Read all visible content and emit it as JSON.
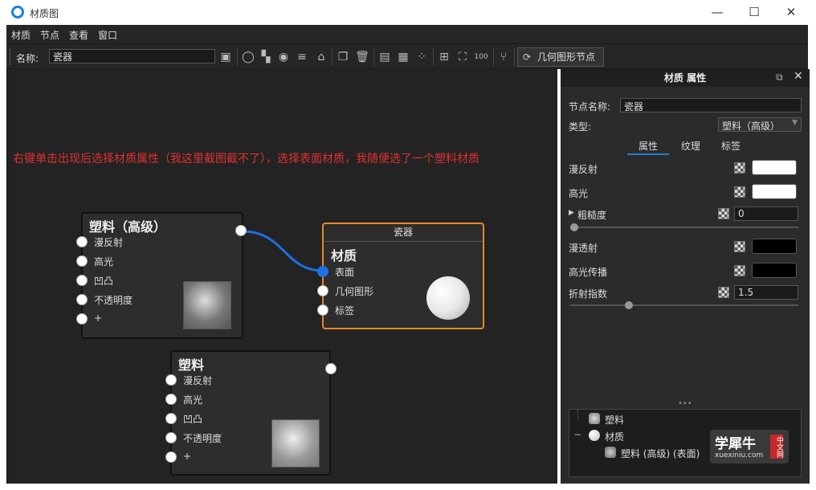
{
  "window": {
    "title": "材质图",
    "min": "—",
    "max": "☐",
    "close": "✕"
  },
  "menu": [
    "材质",
    "节点",
    "查看",
    "窗口"
  ],
  "toolbar": {
    "name_label": "名称:",
    "name_value": "瓷器",
    "geo_button": "几何图形节点"
  },
  "annotation": "右键单击出现后选择材质属性（我这里截图截不了），选择表面材质，我随便选了一个塑料材质",
  "node_plastic_adv": {
    "title": "塑料（高级）",
    "ports": [
      "漫反射",
      "高光",
      "凹凸",
      "不透明度",
      "+"
    ]
  },
  "node_material": {
    "header": "瓷器",
    "title": "材质",
    "ports": [
      "表面",
      "几何图形",
      "标签"
    ]
  },
  "node_plastic": {
    "title": "塑料",
    "ports": [
      "漫反射",
      "高光",
      "凹凸",
      "不透明度",
      "+"
    ]
  },
  "panel": {
    "header": "材质 属性",
    "node_name_label": "节点名称:",
    "node_name_value": "瓷器",
    "type_label": "类型:",
    "type_value": "塑料（高级）",
    "tabs": [
      "属性",
      "纹理",
      "标签"
    ],
    "props": {
      "diffuse": "漫反射",
      "specular": "高光",
      "roughness": "粗糙度",
      "roughness_value": "0",
      "translucency": "漫透射",
      "spec_trans": "高光传播",
      "ior": "折射指数",
      "ior_value": "1.5"
    },
    "ellipsis": "•••",
    "tree": [
      "塑料",
      "材质",
      "塑料 (高级) (表面)"
    ],
    "tree_collapse": "−"
  },
  "watermark": {
    "main": "学犀牛",
    "sub": "xuexiniu.com",
    "badge": "中文网"
  },
  "colors": {
    "accent": "#1e7fd6",
    "annotation": "#e03030",
    "selected_node": "#e8862a",
    "wire": "#1e6fe0"
  }
}
